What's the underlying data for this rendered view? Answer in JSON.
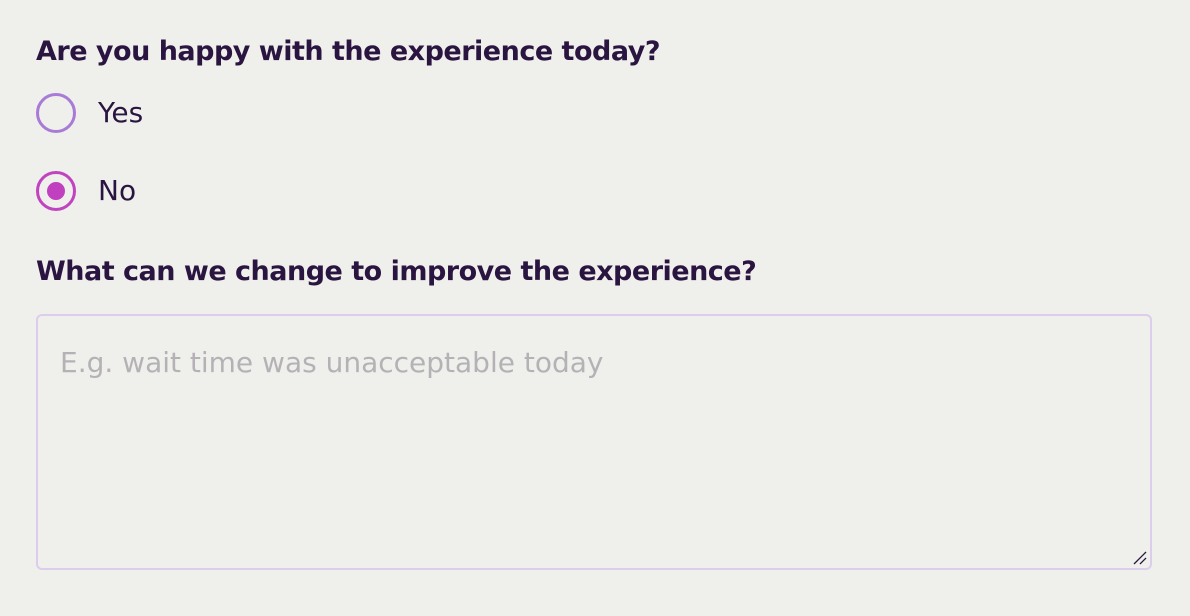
{
  "colors": {
    "background": "#efefec",
    "text_primary": "#2a1440",
    "radio_unchecked_border": "#a77bd6",
    "radio_checked": "#c040bf",
    "textarea_border": "#dccdec",
    "placeholder": "#b5b2b6"
  },
  "happiness_question": {
    "label": "Are you happy with the experience today?",
    "options": [
      {
        "label": "Yes",
        "checked": false
      },
      {
        "label": "No",
        "checked": true
      }
    ]
  },
  "improvement_question": {
    "label": "What can we change to improve the experience?",
    "textarea": {
      "value": "",
      "placeholder": "E.g. wait time was unacceptable today",
      "icon": "resize-handle-icon"
    }
  }
}
